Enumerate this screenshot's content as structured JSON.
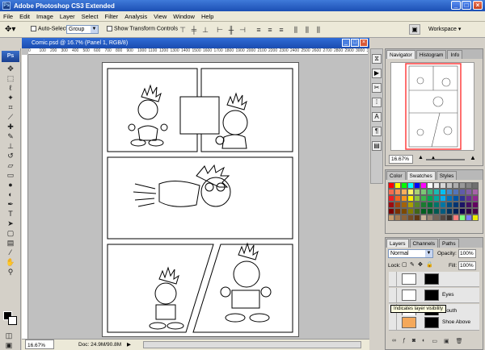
{
  "app": {
    "title": "Adobe Photoshop CS3 Extended",
    "logo": "Ps"
  },
  "menu": [
    "File",
    "Edit",
    "Image",
    "Layer",
    "Select",
    "Filter",
    "Analysis",
    "View",
    "Window",
    "Help"
  ],
  "options_bar": {
    "auto_select_label": "Auto-Select:",
    "auto_select_value": "Group",
    "show_transform_label": "Show Transform Controls",
    "workspace_label": "Workspace"
  },
  "document": {
    "title": "Comic.psd @ 16.7% (Panel 1, RGB/8)",
    "ruler_marks": [
      "0",
      "100",
      "200",
      "300",
      "400",
      "500",
      "600",
      "700",
      "800",
      "900",
      "1000",
      "1100",
      "1200",
      "1300",
      "1400",
      "1500",
      "1600",
      "1700",
      "1800",
      "1900",
      "2000",
      "2100",
      "2200",
      "2300",
      "2400",
      "2500",
      "2600",
      "2700",
      "2800",
      "2900",
      "3000",
      "3100"
    ]
  },
  "status": {
    "zoom": "16.67%",
    "doc_size": "Doc: 24.9M/90.8M"
  },
  "navigator_panel": {
    "tabs": [
      "Navigator",
      "Histogram",
      "Info"
    ],
    "zoom": "16.67%"
  },
  "color_panel": {
    "tabs": [
      "Color",
      "Swatches",
      "Styles"
    ],
    "swatch_colors": [
      "#ff0000",
      "#ffff00",
      "#00ff00",
      "#00ffff",
      "#0000ff",
      "#ff00ff",
      "#ffffff",
      "#ebebeb",
      "#d6d6d6",
      "#c2c2c2",
      "#adadad",
      "#999999",
      "#858585",
      "#707070",
      "#f26c4f",
      "#f68e56",
      "#fbaf5d",
      "#fff568",
      "#acd373",
      "#7cc576",
      "#3bb878",
      "#1abbb4",
      "#00bff3",
      "#438ccb",
      "#5574b9",
      "#605ca8",
      "#855fa8",
      "#a763a8",
      "#ed1c24",
      "#f26522",
      "#f7941d",
      "#fff200",
      "#8dc73f",
      "#39b54a",
      "#00a651",
      "#00a99d",
      "#00aeef",
      "#0072bc",
      "#0054a6",
      "#2e3192",
      "#662d91",
      "#92278f",
      "#9e0b0f",
      "#a0410d",
      "#a36209",
      "#aba000",
      "#598527",
      "#1a7b30",
      "#007236",
      "#00746b",
      "#0076a3",
      "#004b80",
      "#003471",
      "#1b1464",
      "#440e62",
      "#630460",
      "#790000",
      "#7b2e00",
      "#7d4900",
      "#827b00",
      "#406618",
      "#005e20",
      "#005826",
      "#005952",
      "#005b7f",
      "#003663",
      "#002157",
      "#0d004c",
      "#32004b",
      "#4b0049",
      "#c69c6d",
      "#a67c52",
      "#8c6239",
      "#754c24",
      "#603813",
      "#c7b299",
      "#998675",
      "#736357",
      "#534741",
      "#362f2d",
      "#ff7d7d",
      "#7dff7d",
      "#7d7dff",
      "#eeee00"
    ]
  },
  "layers_panel": {
    "tabs": [
      "Layers",
      "Channels",
      "Paths"
    ],
    "blend_mode": "Normal",
    "opacity_label": "Opacity:",
    "opacity_value": "100%",
    "lock_label": "Lock:",
    "fill_label": "Fill:",
    "fill_value": "100%",
    "layers": [
      {
        "name": "",
        "thumb_color": "#ffffff"
      },
      {
        "name": "Eyes",
        "thumb_color": "#ffffff"
      },
      {
        "name": "Mouth",
        "thumb_color": "#ffffff"
      },
      {
        "name": "Shoe Above",
        "thumb_color": "#f4a85a"
      }
    ],
    "tooltip": "Indicates layer visibility"
  },
  "colors": {
    "title_bar": "#1c4fb4",
    "workspace_bg": "#c0c0c0",
    "nav_box": "#ff4040"
  }
}
